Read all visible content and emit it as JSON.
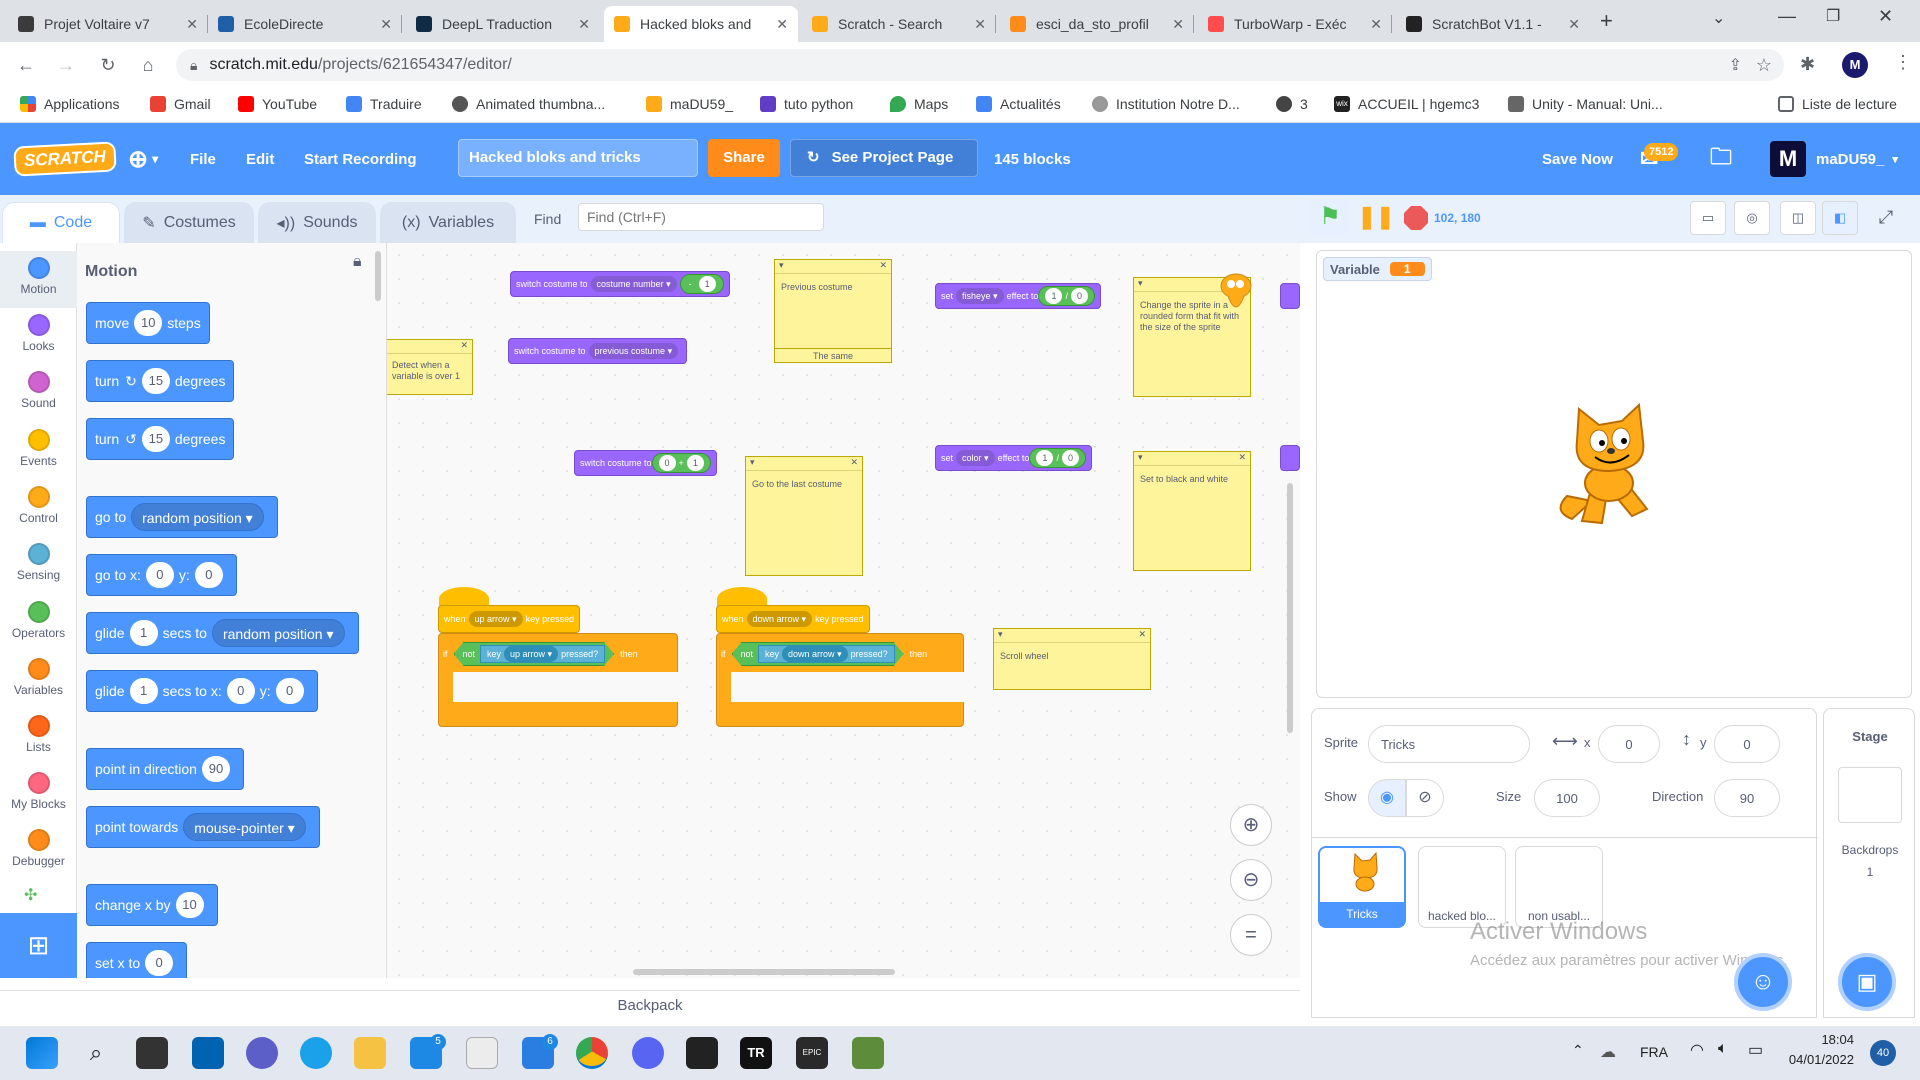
{
  "browser": {
    "tabs": [
      {
        "title": "Projet Voltaire v7",
        "color": "#3b3b3b"
      },
      {
        "title": "EcoleDirecte",
        "color": "#1f5fa8"
      },
      {
        "title": "DeepL Traduction",
        "color": "#0f2b46"
      },
      {
        "title": "Hacked bloks and",
        "color": "#ffab19",
        "active": true
      },
      {
        "title": "Scratch - Search",
        "color": "#ffab19"
      },
      {
        "title": "esci_da_sto_profil",
        "color": "#ff8c1a"
      },
      {
        "title": "TurboWarp - Exéc",
        "color": "#ff4c4c"
      },
      {
        "title": "ScratchBot V1.1 -",
        "color": "#222222"
      }
    ],
    "url_host": "scratch.mit.edu",
    "url_path": "/projects/621654347/editor/",
    "bookmarks": [
      {
        "label": "Applications",
        "color": "#4285f4"
      },
      {
        "label": "Gmail",
        "color": "#ea4335"
      },
      {
        "label": "YouTube",
        "color": "#ff0000"
      },
      {
        "label": "Traduire",
        "color": "#4285f4"
      },
      {
        "label": "Animated thumbna...",
        "color": "#555555"
      },
      {
        "label": "maDU59_",
        "color": "#ffab19"
      },
      {
        "label": "tuto python",
        "color": "#5f3dc4"
      },
      {
        "label": "Maps",
        "color": "#34a853"
      },
      {
        "label": "Actualités",
        "color": "#4285f4"
      },
      {
        "label": "Institution Notre D...",
        "color": "#999999"
      },
      {
        "label": "3",
        "color": "#444444"
      },
      {
        "label": "ACCUEIL | hgemc3",
        "color": "#222222"
      },
      {
        "label": "Unity - Manual: Uni...",
        "color": "#666666"
      }
    ],
    "reading_list": "Liste de lecture"
  },
  "menubar": {
    "logo": "SCRATCH",
    "file": "File",
    "edit": "Edit",
    "recording": "Start Recording",
    "project_title": "Hacked bloks and tricks",
    "share": "Share",
    "see_project": "See Project Page",
    "block_count": "145 blocks",
    "save_now": "Save Now",
    "badge": "7512",
    "username": "maDU59_"
  },
  "editor_tabs": {
    "code": "Code",
    "costumes": "Costumes",
    "sounds": "Sounds",
    "variables": "Variables",
    "find_label": "Find",
    "find_placeholder": "Find (Ctrl+F)"
  },
  "categories": [
    {
      "label": "Motion",
      "color": "#4c97ff"
    },
    {
      "label": "Looks",
      "color": "#9966ff"
    },
    {
      "label": "Sound",
      "color": "#cf63cf"
    },
    {
      "label": "Events",
      "color": "#ffbf00"
    },
    {
      "label": "Control",
      "color": "#ffab19"
    },
    {
      "label": "Sensing",
      "color": "#5cb1d6"
    },
    {
      "label": "Operators",
      "color": "#59c059"
    },
    {
      "label": "Variables",
      "color": "#ff8c1a"
    },
    {
      "label": "Lists",
      "color": "#ff661a"
    },
    {
      "label": "My Blocks",
      "color": "#ff6680"
    },
    {
      "label": "Debugger",
      "color": "#ff8c1a"
    }
  ],
  "palette": {
    "heading": "Motion",
    "move": {
      "a": "move",
      "n": "10",
      "b": "steps"
    },
    "turn_right": {
      "a": "turn",
      "n": "15",
      "b": "degrees"
    },
    "turn_left": {
      "a": "turn",
      "n": "15",
      "b": "degrees"
    },
    "goto": {
      "a": "go to",
      "d": "random position"
    },
    "gotoxy": {
      "a": "go to x:",
      "x": "0",
      "b": "y:",
      "y": "0"
    },
    "glide": {
      "a": "glide",
      "n": "1",
      "b": "secs to",
      "d": "random position"
    },
    "glidexy": {
      "a": "glide",
      "n": "1",
      "b": "secs to x:",
      "x": "0",
      "c": "y:",
      "y": "0"
    },
    "point_dir": {
      "a": "point in direction",
      "n": "90"
    },
    "point_towards": {
      "a": "point towards",
      "d": "mouse-pointer"
    },
    "change_x": {
      "a": "change x by",
      "n": "10"
    },
    "set_x": {
      "a": "set x to",
      "n": "0"
    }
  },
  "workspace": {
    "switch1": {
      "a": "switch costume to",
      "b": "costume",
      "c": "number",
      "d": "-",
      "e": "1"
    },
    "switch2": {
      "a": "switch costume to",
      "b": "previous costume"
    },
    "switch3": {
      "a": "switch costume to",
      "b": "0",
      "c": "+",
      "d": "1"
    },
    "set_fisheye": {
      "a": "set",
      "b": "fisheye",
      "c": "effect to",
      "d": "1",
      "e": "/",
      "f": "0"
    },
    "set_color": {
      "a": "set",
      "b": "color",
      "c": "effect to",
      "d": "1",
      "e": "/",
      "f": "0"
    },
    "note_prev": "Previous costume",
    "note_same": "The same",
    "note_detect": "Detect when a variable is over 1",
    "note_last": "Go to the last costume",
    "note_fisheye": "Change the sprite in a rounded form that fit with the size of the sprite",
    "note_bw": "Set to black and white",
    "note_scroll": "Scroll wheel",
    "hat_up": {
      "a": "when",
      "b": "up arrow",
      "c": "key pressed"
    },
    "if_up": {
      "a": "if",
      "b": "not",
      "c": "key",
      "d": "up arrow",
      "e": "pressed?",
      "f": "then"
    },
    "hat_down": {
      "a": "when",
      "b": "down arrow",
      "c": "key pressed"
    },
    "if_down": {
      "a": "if",
      "b": "not",
      "c": "key",
      "d": "down arrow",
      "e": "pressed?",
      "f": "then"
    }
  },
  "stage": {
    "coords": "102, 180",
    "monitor_label": "Variable",
    "monitor_value": "1"
  },
  "sprite_info": {
    "sprite_label": "Sprite",
    "sprite_name": "Tricks",
    "x_label": "x",
    "x": "0",
    "y_label": "y",
    "y": "0",
    "show_label": "Show",
    "size_label": "Size",
    "size": "100",
    "direction_label": "Direction",
    "direction": "90",
    "sprites": [
      "Tricks",
      "hacked blo...",
      "non usabl..."
    ],
    "stage_title": "Stage",
    "backdrops_label": "Backdrops",
    "backdrops_count": "1",
    "watermark_title": "Activer Windows",
    "watermark_sub": "Accédez aux paramètres pour activer Windows."
  },
  "backpack": "Backpack",
  "taskbar": {
    "lang": "FRA",
    "time": "18:04",
    "date": "04/01/2022",
    "notif": "40",
    "badge_mail": "5",
    "badge_store": "6"
  }
}
